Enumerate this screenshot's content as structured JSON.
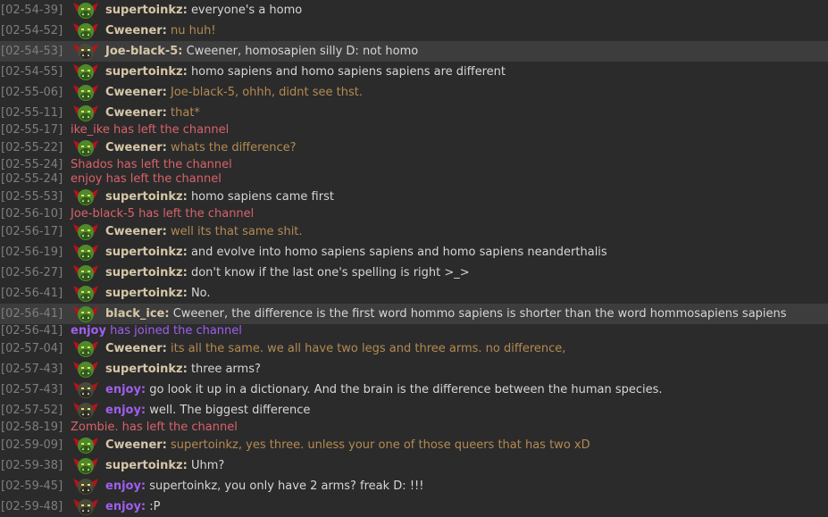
{
  "colors": {
    "timestamp": "#7e7e7e",
    "event": "#d9626b",
    "join": "#9f5ff0",
    "nick_default": "#d6c7a8",
    "nick_enjoy": "#9f5ff0",
    "text_default": "#d6d6d6",
    "text_cweener": "#b48a52"
  },
  "messages": [
    {
      "type": "msg",
      "time": "[02-54-39]",
      "nick": "supertoinkz:",
      "text": "everyone's a homo",
      "avatar": "green-orc-avatar",
      "style": "default"
    },
    {
      "type": "msg",
      "time": "[02-54-52]",
      "nick": "Cweener:",
      "text": "nu huh!",
      "avatar": "green-orc-avatar",
      "style": "cweener"
    },
    {
      "type": "msg",
      "time": "[02-54-53]",
      "nick": "Joe-black-5:",
      "text": "Cweener, homosapien silly D: not homo",
      "avatar": "dark-orc-avatar",
      "style": "default",
      "highlight": true
    },
    {
      "type": "msg",
      "time": "[02-54-55]",
      "nick": "supertoinkz:",
      "text": "homo sapiens and homo sapiens sapiens are different",
      "avatar": "green-orc-avatar",
      "style": "default"
    },
    {
      "type": "msg",
      "time": "[02-55-06]",
      "nick": "Cweener:",
      "text": "Joe-black-5, ohhh, didnt see thst.",
      "avatar": "green-orc-avatar",
      "style": "cweener"
    },
    {
      "type": "msg",
      "time": "[02-55-11]",
      "nick": "Cweener:",
      "text": "that*",
      "avatar": "green-orc-avatar",
      "style": "cweener"
    },
    {
      "type": "event",
      "time": "[02-55-17]",
      "text": "ike_ike has left the channel"
    },
    {
      "type": "msg",
      "time": "[02-55-22]",
      "nick": "Cweener:",
      "text": "whats the difference?",
      "avatar": "green-orc-avatar",
      "style": "cweener"
    },
    {
      "type": "event",
      "time": "[02-55-24]",
      "text": "Shados has left the channel"
    },
    {
      "type": "event",
      "time": "[02-55-24]",
      "text": "enjoy has left the channel"
    },
    {
      "type": "msg",
      "time": "[02-55-53]",
      "nick": "supertoinkz:",
      "text": "homo sapiens came first",
      "avatar": "green-orc-avatar",
      "style": "default"
    },
    {
      "type": "event",
      "time": "[02-56-10]",
      "text": "Joe-black-5 has left the channel"
    },
    {
      "type": "msg",
      "time": "[02-56-17]",
      "nick": "Cweener:",
      "text": "well its that same shit.",
      "avatar": "green-orc-avatar",
      "style": "cweener"
    },
    {
      "type": "msg",
      "time": "[02-56-19]",
      "nick": "supertoinkz:",
      "text": "and evolve into homo sapiens sapiens and homo sapiens neanderthalis",
      "avatar": "green-orc-avatar",
      "style": "default"
    },
    {
      "type": "msg",
      "time": "[02-56-27]",
      "nick": "supertoinkz:",
      "text": "don't know if the last one's spelling is right >_>",
      "avatar": "green-orc-avatar",
      "style": "default"
    },
    {
      "type": "msg",
      "time": "[02-56-41]",
      "nick": "supertoinkz:",
      "text": "No.",
      "avatar": "green-orc-avatar",
      "style": "default"
    },
    {
      "type": "msg",
      "time": "[02-56-41]",
      "nick": "black_ice:",
      "text": "Cweener, the difference is the first word hommo sapiens is shorter than the word hommosapiens sapiens",
      "avatar": "green-orc-avatar",
      "style": "default",
      "highlight": true
    },
    {
      "type": "join",
      "time": "[02-56-41]",
      "who": "enjoy",
      "text": " has joined the channel"
    },
    {
      "type": "msg",
      "time": "[02-57-04]",
      "nick": "Cweener:",
      "text": "its all the same. we all have two legs and three arms. no difference,",
      "avatar": "green-orc-avatar",
      "style": "cweener"
    },
    {
      "type": "msg",
      "time": "[02-57-43]",
      "nick": "supertoinkz:",
      "text": "three arms?",
      "avatar": "green-orc-avatar",
      "style": "default"
    },
    {
      "type": "msg",
      "time": "[02-57-43]",
      "nick": "enjoy:",
      "text": "go look it up in a dictionary. And the brain is the difference between the human species.",
      "avatar": "dark-orc-avatar",
      "style": "enjoy"
    },
    {
      "type": "msg",
      "time": "[02-57-52]",
      "nick": "enjoy:",
      "text": "well. The biggest difference",
      "avatar": "dark-orc-avatar",
      "style": "enjoy"
    },
    {
      "type": "event",
      "time": "[02-58-19]",
      "text": "Zombie. has left the channel"
    },
    {
      "type": "msg",
      "time": "[02-59-09]",
      "nick": "Cweener:",
      "text": "supertoinkz, yes three. unless your one of those queers that has two xD",
      "avatar": "green-orc-avatar",
      "style": "cweener"
    },
    {
      "type": "msg",
      "time": "[02-59-38]",
      "nick": "supertoinkz:",
      "text": "Uhm?",
      "avatar": "green-orc-avatar",
      "style": "default"
    },
    {
      "type": "msg",
      "time": "[02-59-45]",
      "nick": "enjoy:",
      "text": "supertoinkz, you only have 2 arms? freak D: !!!",
      "avatar": "dark-orc-avatar",
      "style": "enjoy"
    },
    {
      "type": "msg",
      "time": "[02-59-48]",
      "nick": "enjoy:",
      "text": ":P",
      "avatar": "dark-orc-avatar",
      "style": "enjoy"
    }
  ]
}
